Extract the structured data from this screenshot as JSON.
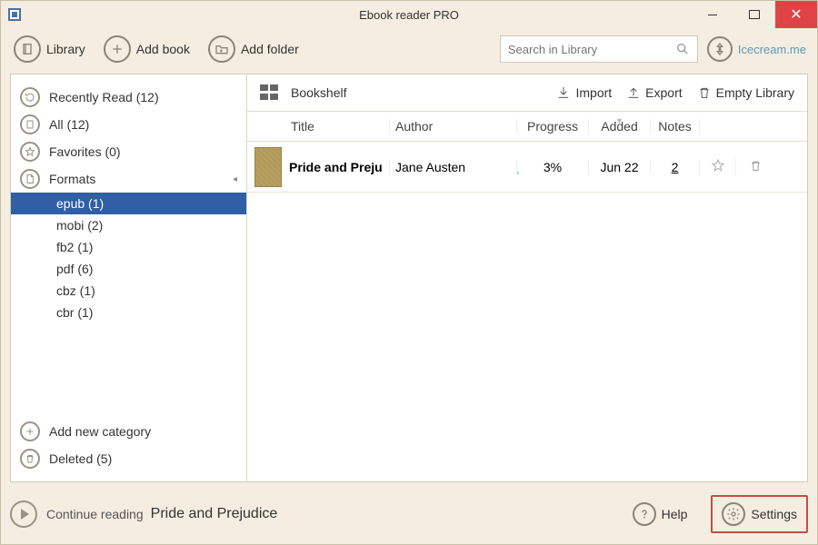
{
  "window": {
    "title": "Ebook reader PRO"
  },
  "toolbar": {
    "library": "Library",
    "addbook": "Add book",
    "addfolder": "Add folder",
    "search_placeholder": "Search in Library",
    "account": "Icecream.me"
  },
  "sidebar": {
    "items": [
      {
        "label": "Recently Read (12)"
      },
      {
        "label": "All (12)"
      },
      {
        "label": "Favorites (0)"
      },
      {
        "label": "Formats"
      }
    ],
    "formats": [
      {
        "label": "epub (1)"
      },
      {
        "label": "mobi (2)"
      },
      {
        "label": "fb2 (1)"
      },
      {
        "label": "pdf (6)"
      },
      {
        "label": "cbz (1)"
      },
      {
        "label": "cbr (1)"
      }
    ],
    "addcat": "Add new category",
    "deleted": "Deleted (5)"
  },
  "content": {
    "shelf": "Bookshelf",
    "import": "Import",
    "export": "Export",
    "empty": "Empty Library",
    "cols": {
      "title": "Title",
      "author": "Author",
      "progress": "Progress",
      "added": "Added",
      "notes": "Notes"
    },
    "rows": [
      {
        "title": "Pride and Preju",
        "author": "Jane Austen",
        "progress": "3%",
        "added": "Jun 22",
        "notes": "2"
      }
    ]
  },
  "status": {
    "continue": "Continue reading",
    "book": "Pride and Prejudice",
    "help": "Help",
    "settings": "Settings"
  }
}
